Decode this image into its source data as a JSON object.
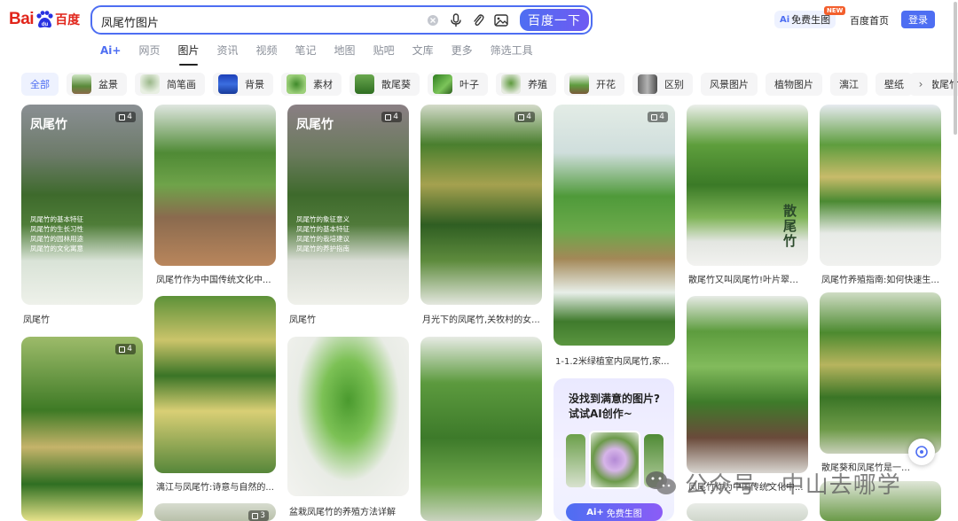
{
  "header": {
    "logo_text": "Bai",
    "logo_cn": "百度",
    "search_query": "凤尾竹图片",
    "search_button": "百度一下",
    "ai_generate_prefix": "Ai",
    "ai_generate_label": "免费生图",
    "new_badge": "NEW",
    "home_link": "百度首页",
    "login_button": "登录"
  },
  "tabs": [
    {
      "label": "Ai+"
    },
    {
      "label": "网页"
    },
    {
      "label": "图片"
    },
    {
      "label": "资讯"
    },
    {
      "label": "视频"
    },
    {
      "label": "笔记"
    },
    {
      "label": "地图"
    },
    {
      "label": "贴吧"
    },
    {
      "label": "文库"
    },
    {
      "label": "更多"
    },
    {
      "label": "筛选工具"
    }
  ],
  "active_tab": "图片",
  "chips": [
    {
      "label": "全部"
    },
    {
      "label": "盆景"
    },
    {
      "label": "简笔画"
    },
    {
      "label": "背景"
    },
    {
      "label": "素材"
    },
    {
      "label": "散尾葵"
    },
    {
      "label": "叶子"
    },
    {
      "label": "养殖"
    },
    {
      "label": "开花"
    },
    {
      "label": "区别"
    },
    {
      "label": "风景图片"
    },
    {
      "label": "植物图片"
    },
    {
      "label": "漓江"
    },
    {
      "label": "壁纸"
    },
    {
      "label": "散尾竹"
    }
  ],
  "results": [
    {
      "caption": "凤尾竹",
      "badge": "4",
      "overlay_title": "凤尾竹",
      "overlay_lines": [
        "凤尾竹的基本特征",
        "凤尾竹的生长习性",
        "凤尾竹的园林用途",
        "凤尾竹的文化寓意"
      ]
    },
    {
      "caption": "凤尾竹作为中国传统文化中..."
    },
    {
      "caption": "凤尾竹",
      "badge": "4",
      "overlay_title": "凤尾竹",
      "overlay_lines": [
        "凤尾竹的象征意义",
        "凤尾竹的基本特征",
        "凤尾竹的栽培建议",
        "凤尾竹的养护指南"
      ]
    },
    {
      "caption": "月光下的凤尾竹,关牧村的女...",
      "badge": "4"
    },
    {
      "caption": "1-1.2米绿植室内凤尾竹,家...",
      "badge": "4"
    },
    {
      "caption": "散尾竹又叫凤尾竹!叶片翠绿...",
      "vertical_text": "散尾竹"
    },
    {
      "caption": "凤尾竹养殖指南:如何快速生..."
    },
    {
      "caption": "",
      "badge": "4"
    },
    {
      "caption": "漓江与凤尾竹:诗意与自然的..."
    },
    {
      "caption": "盆栽凤尾竹的养殖方法详解"
    },
    {
      "caption": ""
    },
    {
      "caption": "凤尾竹作为中国传统文化中..."
    },
    {
      "caption": "散尾葵和凤尾竹是一种植物..."
    },
    {
      "caption": "",
      "badge": "3"
    }
  ],
  "promo": {
    "line1": "没找到满意的图片?",
    "line2": "试试AI创作~",
    "button_prefix": "Ai+",
    "button_label": "免费生图"
  },
  "watermark": "公众号 · 中山去哪学"
}
